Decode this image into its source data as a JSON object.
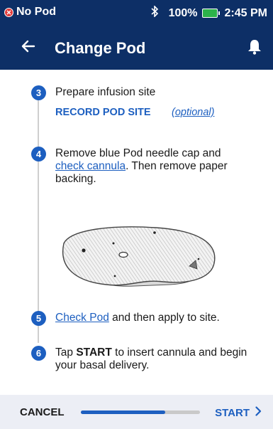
{
  "status_bar": {
    "pod_status": "No Pod",
    "battery_percent": "100%",
    "time": "2:45 PM",
    "icons": [
      "alert-icon",
      "bluetooth-icon",
      "battery-icon"
    ]
  },
  "header": {
    "title": "Change Pod",
    "back_icon": "arrow-left-icon",
    "bell_icon": "bell-icon"
  },
  "steps": [
    {
      "number": "3",
      "text": "Prepare infusion site",
      "record_label": "RECORD POD SITE",
      "optional_label": "(optional)"
    },
    {
      "number": "4",
      "text_before_link": "Remove blue Pod needle cap and ",
      "link": "check cannula",
      "text_after_link": ". Then remove paper backing."
    },
    {
      "number": "5",
      "link": "Check Pod",
      "text_after_link": " and then apply to site."
    },
    {
      "number": "6",
      "text_before_bold": "Tap ",
      "bold": "START",
      "text_after_bold": " to insert cannula and begin your basal delivery."
    }
  ],
  "footer": {
    "cancel_label": "CANCEL",
    "start_label": "START",
    "progress_fraction": 0.71
  },
  "colors": {
    "primary_navy": "#0d2f66",
    "accent_blue": "#1d5fc0",
    "footer_bg": "#eceef5",
    "alert_red": "#e23b3b",
    "battery_green": "#2cb34a"
  }
}
